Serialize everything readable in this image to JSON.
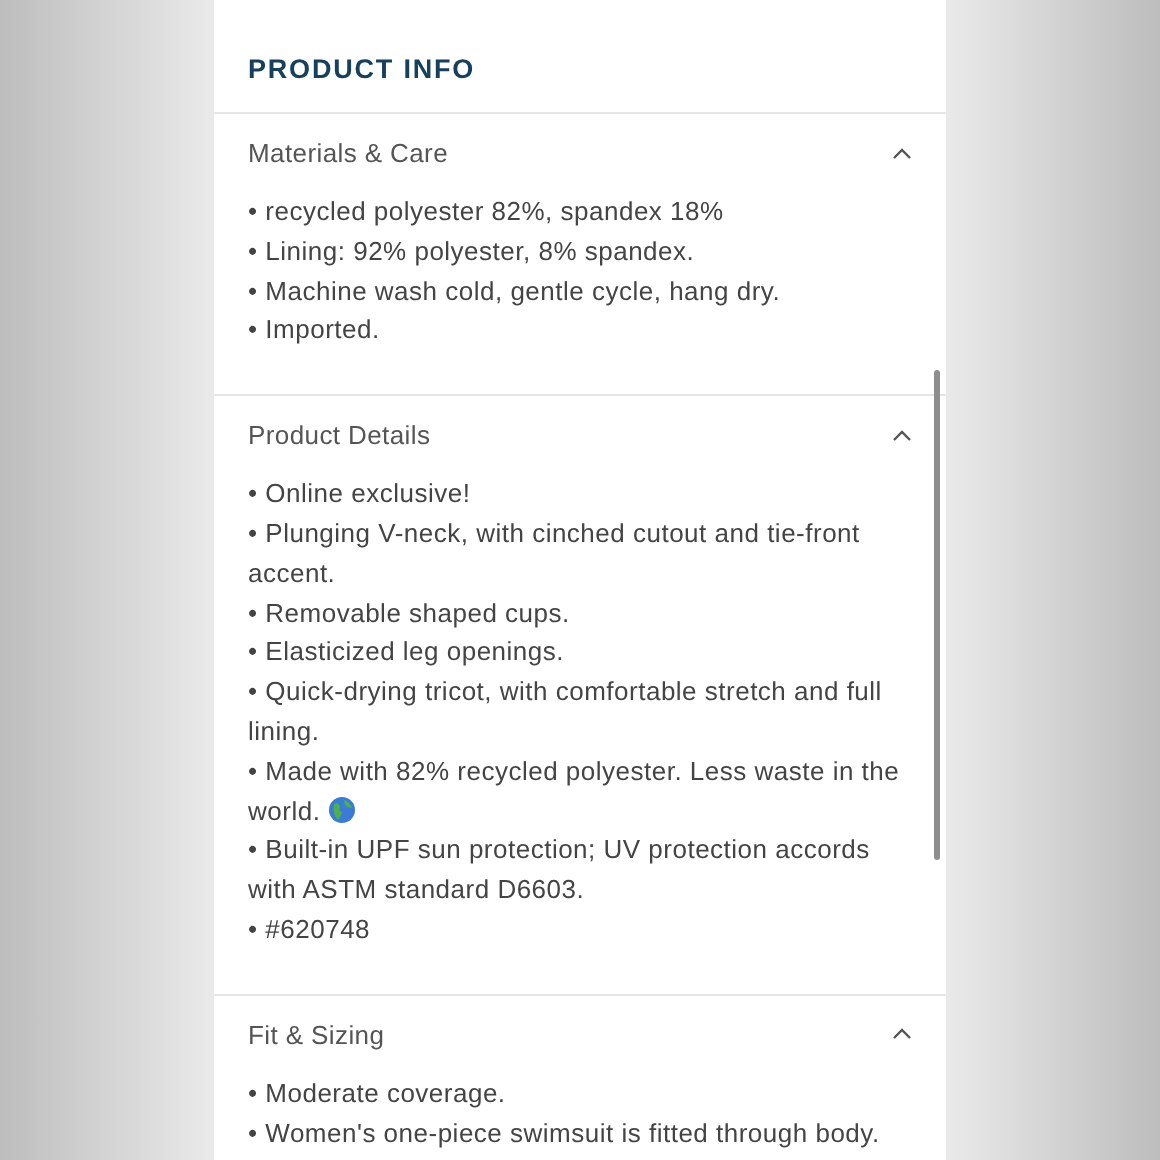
{
  "title": "PRODUCT INFO",
  "sections": [
    {
      "heading": "Materials & Care",
      "expanded": true,
      "lines": [
        {
          "text": "• recycled polyester 82%, spandex 18%"
        },
        {
          "text": "• Lining: 92% polyester, 8% spandex."
        },
        {
          "text": "• Machine wash cold, gentle cycle, hang dry."
        },
        {
          "text": "• Imported."
        }
      ]
    },
    {
      "heading": "Product Details",
      "expanded": true,
      "lines": [
        {
          "text": "• Online exclusive!"
        },
        {
          "text": "• Plunging V-neck, with cinched cutout and tie-front accent."
        },
        {
          "text": "• Removable shaped cups."
        },
        {
          "text": "• Elasticized leg openings."
        },
        {
          "text": "• Quick-drying tricot, with comfortable stretch and full lining."
        },
        {
          "text": "• Made with 82% recycled polyester. Less waste in the world.",
          "kind": "emoji"
        },
        {
          "text": "• Built-in UPF sun protection; UV protection accords with ASTM standard D6603."
        },
        {
          "text": "• #620748"
        }
      ]
    },
    {
      "heading": "Fit & Sizing",
      "expanded": true,
      "lines": [
        {
          "text": "• Moderate coverage."
        },
        {
          "text": "• Women's one-piece swimsuit is fitted through body."
        }
      ]
    }
  ]
}
